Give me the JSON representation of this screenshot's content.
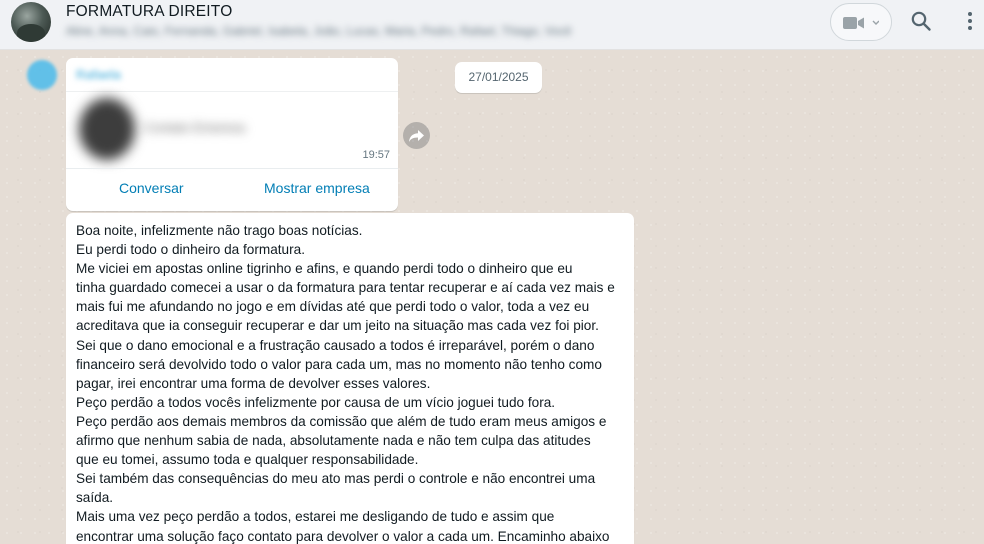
{
  "header": {
    "title": "FORMATURA DIREITO",
    "members": "Aline, Anna, Caio, Fernanda, Gabriel, Isabela, João, Lucas, Maria, Pedro, Rafael, Thiago, Você"
  },
  "contact_card": {
    "sender": "Rafaela",
    "name": "Contato Empresa",
    "time": "19:57",
    "buttons": {
      "chat": "Conversar",
      "business": "Mostrar empresa"
    }
  },
  "date_badge": "27/01/2025",
  "message": {
    "lines": [
      "Boa noite, infelizmente não trago boas notícias.",
      "Eu perdi todo o dinheiro da formatura.",
      "Me viciei em apostas online tigrinho e afins, e quando perdi todo o dinheiro que eu",
      "tinha guardado comecei a usar o da formatura para tentar recuperar e aí cada vez mais e",
      "mais fui me afundando no jogo e em dívidas até que perdi todo o valor, toda a vez eu",
      "acreditava que ia conseguir recuperar e dar um jeito na situação mas cada vez foi pior.",
      "Sei que o dano emocional e a frustração  causado a todos é irreparável, porém o dano",
      "financeiro será devolvido todo o valor para cada um, mas no momento não tenho como",
      "pagar, irei encontrar uma forma de devolver esses valores.",
      "Peço perdão a todos vocês infelizmente por causa de um vício joguei tudo fora.",
      "Peço perdão aos demais membros da comissão que além de tudo eram meus amigos e",
      "afirmo que nenhum sabia de nada, absolutamente nada e não tem culpa das atitudes",
      "que eu tomei, assumo toda e qualquer responsabilidade.",
      "Sei também das consequências do meu ato mas perdi o controle e não encontrei uma",
      "saída.",
      "Mais uma vez peço perdão a todos, estarei me desligando de tudo e assim que",
      "encontrar uma solução faço contato para devolver o valor a cada um. Encaminho abaixo"
    ]
  },
  "icons": {
    "video": "video-camera-icon",
    "search": "search-icon",
    "menu": "more-vertical-icon",
    "forward": "forward-icon"
  }
}
